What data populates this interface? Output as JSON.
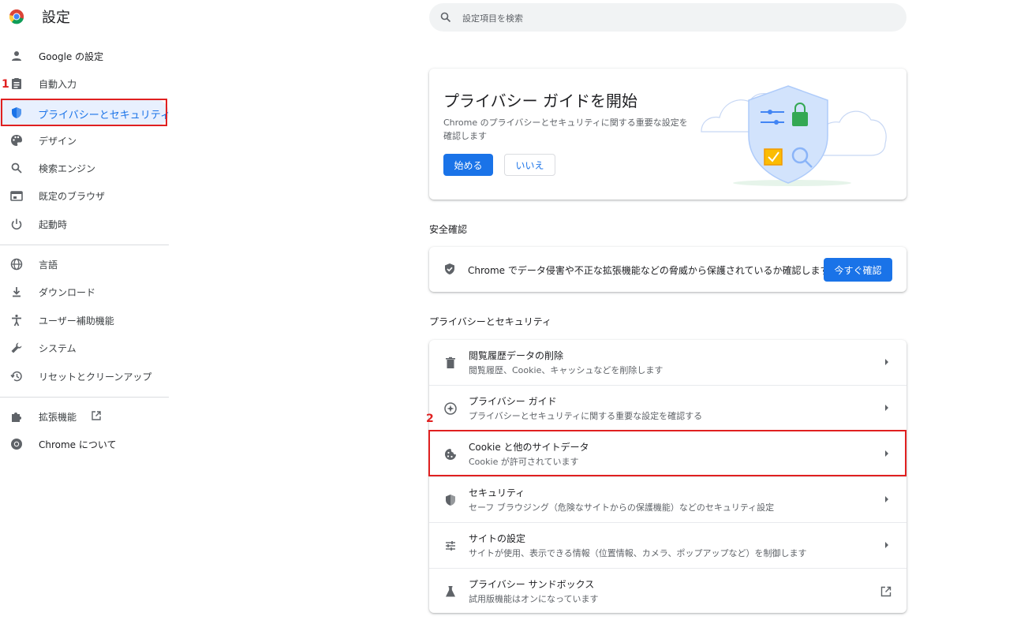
{
  "header": {
    "title": "設定"
  },
  "search": {
    "placeholder": "設定項目を検索"
  },
  "sidebar": {
    "items": [
      {
        "label": "Google の設定",
        "icon": "person-icon"
      },
      {
        "label": "自動入力",
        "icon": "clipboard-icon"
      },
      {
        "label": "プライバシーとセキュリティ",
        "icon": "shield-icon",
        "active": true
      },
      {
        "label": "デザイン",
        "icon": "palette-icon"
      },
      {
        "label": "検索エンジン",
        "icon": "search-icon"
      },
      {
        "label": "既定のブラウザ",
        "icon": "browser-icon"
      },
      {
        "label": "起動時",
        "icon": "power-icon"
      },
      {
        "label": "言語",
        "icon": "globe-icon"
      },
      {
        "label": "ダウンロード",
        "icon": "download-icon"
      },
      {
        "label": "ユーザー補助機能",
        "icon": "accessibility-icon"
      },
      {
        "label": "システム",
        "icon": "wrench-icon"
      },
      {
        "label": "リセットとクリーンアップ",
        "icon": "restore-icon"
      },
      {
        "label": "拡張機能",
        "icon": "puzzle-icon"
      },
      {
        "label": "Chrome について",
        "icon": "chrome-icon"
      }
    ]
  },
  "annotations": {
    "step1": "1",
    "step2": "2"
  },
  "privacy_guide_card": {
    "title": "プライバシー ガイドを開始",
    "description": "Chrome のプライバシーとセキュリティに関する重要な設定を確認します",
    "start_button": "始める",
    "no_button": "いいえ"
  },
  "safety_check": {
    "heading": "安全確認",
    "text": "Chrome でデータ侵害や不正な拡張機能などの脅威から保護されているか確認します",
    "button": "今すぐ確認"
  },
  "privacy_section": {
    "heading": "プライバシーとセキュリティ",
    "rows": [
      {
        "title": "閲覧履歴データの削除",
        "subtitle": "閲覧履歴、Cookie、キャッシュなどを削除します",
        "icon": "trash-icon"
      },
      {
        "title": "プライバシー ガイド",
        "subtitle": "プライバシーとセキュリティに関する重要な設定を確認する",
        "icon": "compass-icon"
      },
      {
        "title": "Cookie と他のサイトデータ",
        "subtitle": "Cookie が許可されています",
        "icon": "cookie-icon"
      },
      {
        "title": "セキュリティ",
        "subtitle": "セーフ ブラウジング（危険なサイトからの保護機能）などのセキュリティ設定",
        "icon": "security-shield-icon"
      },
      {
        "title": "サイトの設定",
        "subtitle": "サイトが使用、表示できる情報（位置情報、カメラ、ポップアップなど）を制御します",
        "icon": "tune-icon"
      },
      {
        "title": "プライバシー サンドボックス",
        "subtitle": "試用版機能はオンになっています",
        "icon": "flask-icon"
      }
    ]
  },
  "colors": {
    "accent": "#1a73e8",
    "highlight": "#e02020"
  }
}
